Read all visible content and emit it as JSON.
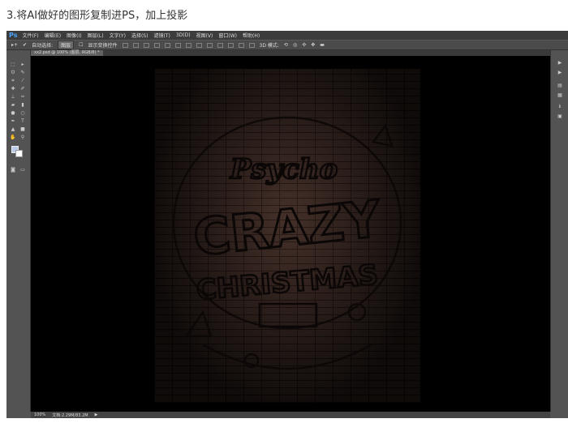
{
  "heading": "3.将AI做好的图形复制进PS，加上投影",
  "app": {
    "logo": "Ps",
    "menu": [
      "文件(F)",
      "编辑(E)",
      "图像(I)",
      "图层(L)",
      "文字(Y)",
      "选择(S)",
      "滤镜(T)",
      "3D(D)",
      "视图(V)",
      "窗口(W)",
      "帮助(H)"
    ],
    "options": {
      "auto_select": "自动选择:",
      "auto_select_value": "图层",
      "show_transform": "显示变换控件",
      "mode_3d": "3D 模式:"
    },
    "tab": "xx2.psd @ 100% (图层, RGB/8) *",
    "status": {
      "zoom": "100%",
      "doc": "文档:2.29M/83.2M"
    }
  },
  "artwork": {
    "line1": "Psycho",
    "line2": "CRAZY",
    "line3": "CHRISTMAS"
  }
}
